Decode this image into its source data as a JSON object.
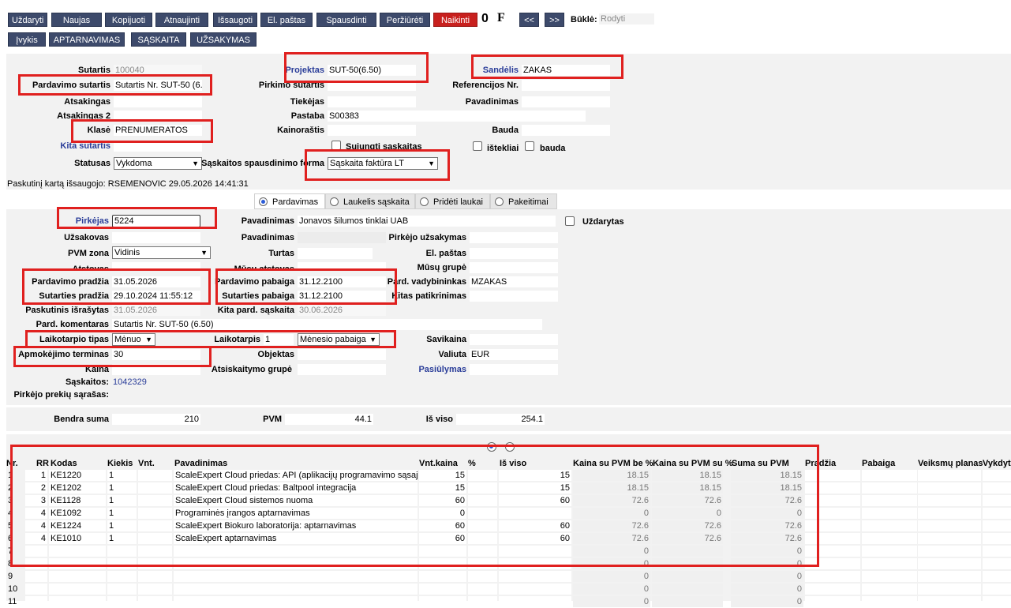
{
  "toolbar": {
    "row1": [
      "Uždaryti",
      "Naujas",
      "Kopijuoti",
      "Atnaujinti",
      "Išsaugoti",
      "El. paštas",
      "Spausdinti",
      "Peržiūrėti",
      "Naikinti"
    ],
    "attach_glyph": "0",
    "font_glyph": "F",
    "prev": "<<",
    "next": ">>",
    "state_label": "Būklė:",
    "state_value": "Rodyti",
    "row2": [
      "Įvykis",
      "APTARNAVIMAS",
      "SĄSKAITA",
      "UŽSAKYMAS"
    ]
  },
  "header": {
    "sutartis": {
      "label": "Sutartis",
      "value": "100040"
    },
    "pardavimo_sutartis": {
      "label": "Pardavimo sutartis",
      "value": "Sutartis Nr. SUT-50 (6."
    },
    "atsakingas": {
      "label": "Atsakingas",
      "value": ""
    },
    "atsakingas2": {
      "label": "Atsakingas 2",
      "value": ""
    },
    "klase": {
      "label": "Klasė",
      "value": "PRENUMERATOS"
    },
    "kita_sutartis": {
      "label": "Kita sutartis",
      "value": ""
    },
    "statusas": {
      "label": "Statusas",
      "value": "Vykdoma"
    },
    "projektas": {
      "label": "Projektas",
      "value": "SUT-50(6.50)"
    },
    "pirkimo_sutartis": {
      "label": "Pirkimo sutartis",
      "value": ""
    },
    "tiekejas": {
      "label": "Tiekėjas",
      "value": ""
    },
    "pastaba": {
      "label": "Pastaba",
      "value": "S00383"
    },
    "kainorastis": {
      "label": "Kainoraštis",
      "value": ""
    },
    "sujungti": "Sujungti sąskaitas",
    "spausdinimo_forma": {
      "label": "Sąskaitos spausdinimo forma",
      "value": "Sąskaita faktūra LT"
    },
    "sandelis": {
      "label": "Sandėlis",
      "value": "ZAKAS"
    },
    "referencijos": {
      "label": "Referencijos Nr.",
      "value": ""
    },
    "pavadinimas": {
      "label": "Pavadinimas",
      "value": ""
    },
    "bauda": {
      "label": "Bauda",
      "value": ""
    },
    "istekliai": "ištekliai",
    "bauda_cb": "bauda",
    "saved_note": "Paskutinį kartą išsaugojo: RSEMENOVIC 29.05.2026 14:41:31"
  },
  "tabs": [
    "Pardavimas",
    "Laukelis sąskaita",
    "Pridėti laukai",
    "Pakeitimai"
  ],
  "sale": {
    "pirkejas": {
      "label": "Pirkėjas",
      "value": "5224"
    },
    "uzsakovas": {
      "label": "Užsakovas",
      "value": ""
    },
    "pvm_zona": {
      "label": "PVM zona",
      "value": "Vidinis"
    },
    "atstovas": {
      "label": "Atstovas",
      "value": ""
    },
    "pardavimo_pradzia": {
      "label": "Pardavimo pradžia",
      "value": "31.05.2026"
    },
    "sutarties_pradzia": {
      "label": "Sutarties pradžia",
      "value": "29.10.2024 11:55:12"
    },
    "paskutinis": {
      "label": "Paskutinis išrašytas",
      "value": "31.05.2026"
    },
    "komentaras": {
      "label": "Pard. komentaras",
      "value": "Sutartis Nr. SUT-50 (6.50)"
    },
    "laikotarpio_tipas": {
      "label": "Laikotarpio tipas",
      "value": "Mėnuo"
    },
    "apmokejimo": {
      "label": "Apmokėjimo terminas",
      "value": "30"
    },
    "kaina": {
      "label": "Kaina",
      "value": ""
    },
    "saskaitos": {
      "label": "Sąskaitos:",
      "value": "1042329"
    },
    "prekiu_sarasas": {
      "label": "Pirkėjo prekių sąrašas:"
    },
    "pavadinimas1": {
      "label": "Pavadinimas",
      "value": "Jonavos šilumos tinklai UAB"
    },
    "pavadinimas2": {
      "label": "Pavadinimas",
      "value": ""
    },
    "turtas": {
      "label": "Turtas",
      "value": ""
    },
    "musu_atstovas": {
      "label": "Mūsų atstovas",
      "value": ""
    },
    "pardavimo_pabaiga": {
      "label": "Pardavimo pabaiga",
      "value": "31.12.2100"
    },
    "sutarties_pabaiga": {
      "label": "Sutarties pabaiga",
      "value": "31.12.2100"
    },
    "kita_pard": {
      "label": "Kita pard. sąskaita",
      "value": "30.06.2026"
    },
    "laikotarpis": {
      "label": "Laikotarpis",
      "value": "1"
    },
    "laik_sel": "Mėnesio pabaiga",
    "objektas": {
      "label": "Objektas",
      "value": ""
    },
    "atsiskaitymo": {
      "label": "Atsiskaitymo grupė",
      "value": ""
    },
    "uzdarytas": "Uždarytas",
    "pirkejo_uzsakymas": {
      "label": "Pirkėjo užsakymas",
      "value": ""
    },
    "el_pastas": {
      "label": "El. paštas",
      "value": ""
    },
    "musu_grupe": {
      "label": "Mūsų grupė",
      "value": ""
    },
    "vadybininkas": {
      "label": "Pard. vadybininkas",
      "value": "MZAKAS"
    },
    "kitas_patikrinimas": {
      "label": "Kitas patikrinimas",
      "value": ""
    },
    "savikaina": {
      "label": "Savikaina",
      "value": ""
    },
    "valiuta": {
      "label": "Valiuta",
      "value": "EUR"
    },
    "pasiulymas": {
      "label": "Pasiūlymas",
      "value": ""
    }
  },
  "totals": {
    "bendra": {
      "label": "Bendra suma",
      "value": "210"
    },
    "pvm": {
      "label": "PVM",
      "value": "44.1"
    },
    "is_viso": {
      "label": "Iš viso",
      "value": "254.1"
    }
  },
  "grid": {
    "headers": [
      "Nr.",
      "RR",
      "Kodas",
      "Kiekis",
      "Vnt.",
      "Pavadinimas",
      "Vnt.kaina",
      "%",
      "Iš viso",
      "Kaina su PVM be %",
      "Kaina su PVM su %",
      "Suma su PVM",
      "Pradžia",
      "Pabaiga",
      "Veiksmų planas",
      "Vykdyt"
    ],
    "rows": [
      [
        "1",
        "1",
        "KE1220",
        "1",
        "",
        "ScaleExpert Cloud priedas: API (aplikacijų programavimo sąsaja)",
        "15",
        "",
        "15",
        "18.15",
        "18.15",
        "18.15"
      ],
      [
        "2",
        "2",
        "KE1202",
        "1",
        "",
        "ScaleExpert Cloud priedas: Baltpool integracija",
        "15",
        "",
        "15",
        "18.15",
        "18.15",
        "18.15"
      ],
      [
        "3",
        "3",
        "KE1128",
        "1",
        "",
        "ScaleExpert Cloud sistemos nuoma",
        "60",
        "",
        "60",
        "72.6",
        "72.6",
        "72.6"
      ],
      [
        "4",
        "4",
        "KE1092",
        "1",
        "",
        "Programinės įrangos aptarnavimas",
        "0",
        "",
        "",
        "0",
        "0",
        "0"
      ],
      [
        "5",
        "4",
        "KE1224",
        "1",
        "",
        "ScaleExpert Biokuro laboratorija: aptarnavimas",
        "60",
        "",
        "60",
        "72.6",
        "72.6",
        "72.6"
      ],
      [
        "6",
        "4",
        "KE1010",
        "1",
        "",
        "ScaleExpert aptarnavimas",
        "60",
        "",
        "60",
        "72.6",
        "72.6",
        "72.6"
      ],
      [
        "7",
        "",
        "",
        "",
        "",
        "",
        "",
        "",
        "",
        "0",
        "",
        "0"
      ],
      [
        "8",
        "",
        "",
        "",
        "",
        "",
        "",
        "",
        "",
        "0",
        "",
        "0"
      ],
      [
        "9",
        "",
        "",
        "",
        "",
        "",
        "",
        "",
        "",
        "0",
        "",
        "0"
      ],
      [
        "10",
        "",
        "",
        "",
        "",
        "",
        "",
        "",
        "",
        "0",
        "",
        "0"
      ],
      [
        "11",
        "",
        "",
        "",
        "",
        "",
        "",
        "",
        "",
        "0",
        "",
        "0"
      ]
    ]
  }
}
